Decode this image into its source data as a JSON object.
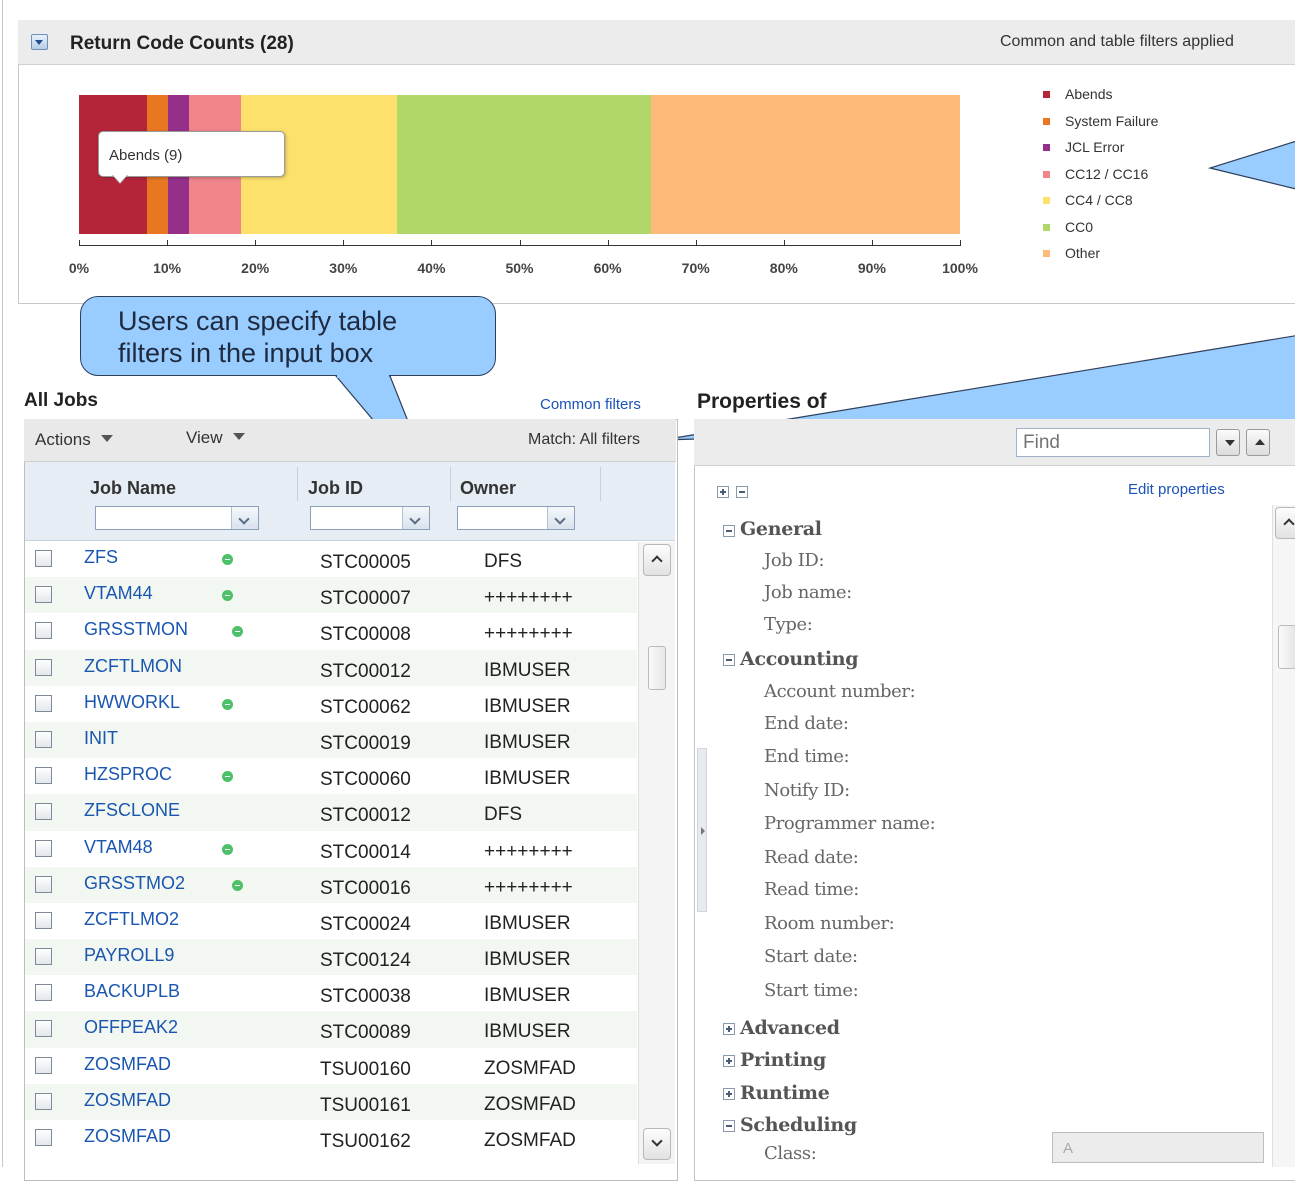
{
  "return_code_panel": {
    "title": "Return Code Counts (28)",
    "filters_note": "Common and table filters applied",
    "tooltip": "Abends (9)",
    "legend": [
      {
        "label": "Abends",
        "color": "#b5253a"
      },
      {
        "label": "System Failure",
        "color": "#e87722"
      },
      {
        "label": "JCL Error",
        "color": "#94308a"
      },
      {
        "label": "CC12 / CC16",
        "color": "#f0858a"
      },
      {
        "label": "CC4 / CC8",
        "color": "#fde16c"
      },
      {
        "label": "CC0",
        "color": "#b1d769"
      },
      {
        "label": "Other",
        "color": "#fdba78"
      }
    ]
  },
  "chart_data": {
    "type": "bar",
    "orientation": "horizontal-stacked",
    "title": "Return Code Counts (28)",
    "xlabel": "",
    "ylabel": "",
    "xlim": [
      0,
      100
    ],
    "x_ticks": [
      "0%",
      "10%",
      "20%",
      "30%",
      "40%",
      "50%",
      "60%",
      "70%",
      "80%",
      "90%",
      "100%"
    ],
    "series": [
      {
        "name": "Abends",
        "percent": 7.7,
        "color": "#b5253a"
      },
      {
        "name": "System Failure",
        "percent": 2.4,
        "color": "#e87722"
      },
      {
        "name": "JCL Error",
        "percent": 2.4,
        "color": "#94308a"
      },
      {
        "name": "CC12 / CC16",
        "percent": 5.9,
        "color": "#f0858a"
      },
      {
        "name": "CC4 / CC8",
        "percent": 17.7,
        "color": "#fde16c"
      },
      {
        "name": "CC0",
        "percent": 28.9,
        "color": "#b1d769"
      },
      {
        "name": "Other",
        "percent": 35.0,
        "color": "#fdba78"
      }
    ],
    "grid": false,
    "legend_position": "right"
  },
  "callout": {
    "line1": "Users can specify table",
    "line2": "filters in the input box"
  },
  "jobs": {
    "title": "All Jobs",
    "common_filters_link": "Common filters",
    "actions_label": "Actions",
    "view_label": "View",
    "match_note": "Match: All filters",
    "columns": [
      "Job Name",
      "Job ID",
      "Owner"
    ],
    "rows": [
      {
        "name": "ZFS",
        "status": "active",
        "job_id": "STC00005",
        "owner": "DFS"
      },
      {
        "name": "VTAM44",
        "status": "active",
        "job_id": "STC00007",
        "owner": "++++++++"
      },
      {
        "name": "GRSSTMON",
        "status": "active",
        "job_id": "STC00008",
        "owner": "++++++++"
      },
      {
        "name": "ZCFTLMON",
        "status": "",
        "job_id": "STC00012",
        "owner": "IBMUSER"
      },
      {
        "name": "HWWORKL",
        "status": "active",
        "job_id": "STC00062",
        "owner": "IBMUSER"
      },
      {
        "name": "INIT",
        "status": "",
        "job_id": "STC00019",
        "owner": "IBMUSER"
      },
      {
        "name": "HZSPROC",
        "status": "active",
        "job_id": "STC00060",
        "owner": "IBMUSER"
      },
      {
        "name": "ZFSCLONE",
        "status": "",
        "job_id": "STC00012",
        "owner": "DFS"
      },
      {
        "name": "VTAM48",
        "status": "active",
        "job_id": "STC00014",
        "owner": "++++++++"
      },
      {
        "name": "GRSSTMO2",
        "status": "active",
        "job_id": "STC00016",
        "owner": "++++++++"
      },
      {
        "name": "ZCFTLMO2",
        "status": "",
        "job_id": "STC00024",
        "owner": "IBMUSER"
      },
      {
        "name": "PAYROLL9",
        "status": "",
        "job_id": "STC00124",
        "owner": "IBMUSER"
      },
      {
        "name": "BACKUPLB",
        "status": "",
        "job_id": "STC00038",
        "owner": "IBMUSER"
      },
      {
        "name": "OFFPEAK2",
        "status": "",
        "job_id": "STC00089",
        "owner": "IBMUSER"
      },
      {
        "name": "ZOSMFAD",
        "status": "",
        "job_id": "TSU00160",
        "owner": "ZOSMFAD"
      },
      {
        "name": "ZOSMFAD",
        "status": "",
        "job_id": "TSU00161",
        "owner": "ZOSMFAD"
      },
      {
        "name": "ZOSMFAD",
        "status": "",
        "job_id": "TSU00162",
        "owner": "ZOSMFAD"
      }
    ]
  },
  "properties": {
    "title": "Properties of",
    "find_placeholder": "Find",
    "edit_link": "Edit properties",
    "general": {
      "label": "General",
      "fields": [
        "Job ID:",
        "Job name:",
        "Type:"
      ]
    },
    "accounting": {
      "label": "Accounting",
      "fields": [
        "Account number:",
        "End date:",
        "End time:",
        "Notify ID:",
        "Programmer name:",
        "Read date:",
        "Read time:",
        "Room number:",
        "Start date:",
        "Start time:"
      ]
    },
    "advanced": "Advanced",
    "printing": "Printing",
    "runtime": "Runtime",
    "scheduling": {
      "label": "Scheduling",
      "class_label": "Class:",
      "class_value": "A"
    }
  }
}
